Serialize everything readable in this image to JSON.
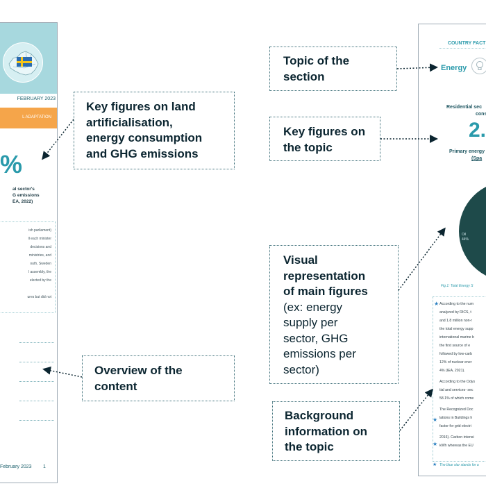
{
  "left_doc": {
    "date": "FEBRUARY 2023",
    "band_text": "L ADAPTATION",
    "big_figure": "%",
    "figure_caption": [
      "al sector's",
      "G emissions",
      "EA, 2022)"
    ],
    "body_lines": [
      "ish parliament)",
      "ll each minister",
      "decisions and",
      "ministries, and",
      "outh, Sweden",
      "l assembly, the",
      "elected by the",
      "",
      "ures but did not"
    ],
    "footer_date": "February 2023",
    "page_number": "1",
    "flag_icon": "sweden-flag-icon",
    "map_icon": "europe-map-icon"
  },
  "right_doc": {
    "header": "COUNTRY FACT",
    "topic": "Energy",
    "topic_icon": "lightbulb-icon",
    "caption_1": "Residential sec",
    "caption_2": "consum",
    "big_figure": "2.",
    "caption_3": "Primary energy",
    "caption_4": "(Spa",
    "pie_label_1": "Oil",
    "pie_label_2": "44%",
    "fig_caption": "Fig.1: Total Energy S",
    "bg_lines": [
      "According to the num",
      "analyzed by RICS, t",
      "and 1.8 million non-r",
      "the total energy supp",
      "international marine b",
      "the first source of e",
      "followed by low-carb",
      "12% of nuclear ener",
      "4% (IEA, 2021).",
      "According to the Odys",
      "tial and services- sec",
      "58.1% of which come",
      "The Recognized Doc",
      "lations in Buildings h",
      "factor for grid electri",
      "2016). Carbon intensi",
      "kWh whereas the EU"
    ],
    "footnote": "The blue star stands for a",
    "colors": {
      "teal": "#2a9aab",
      "pie": "#1e4a4a",
      "orange": "#f5a54a"
    }
  },
  "callouts": {
    "key_figures_land": [
      "Key figures on land",
      "artificialisation,",
      "energy consumption",
      "and GHG emissions"
    ],
    "overview": [
      "Overview of the",
      "content"
    ],
    "topic_section": [
      "Topic of the",
      "section"
    ],
    "key_figures_topic": [
      "Key figures on",
      "the topic"
    ],
    "visual_bold": [
      "Visual",
      "representation",
      "of main figures"
    ],
    "visual_normal": [
      "(ex: energy",
      "supply per",
      "sector, GHG",
      "emissions per",
      "sector)"
    ],
    "background": [
      "Background",
      "information on",
      "the topic"
    ]
  }
}
